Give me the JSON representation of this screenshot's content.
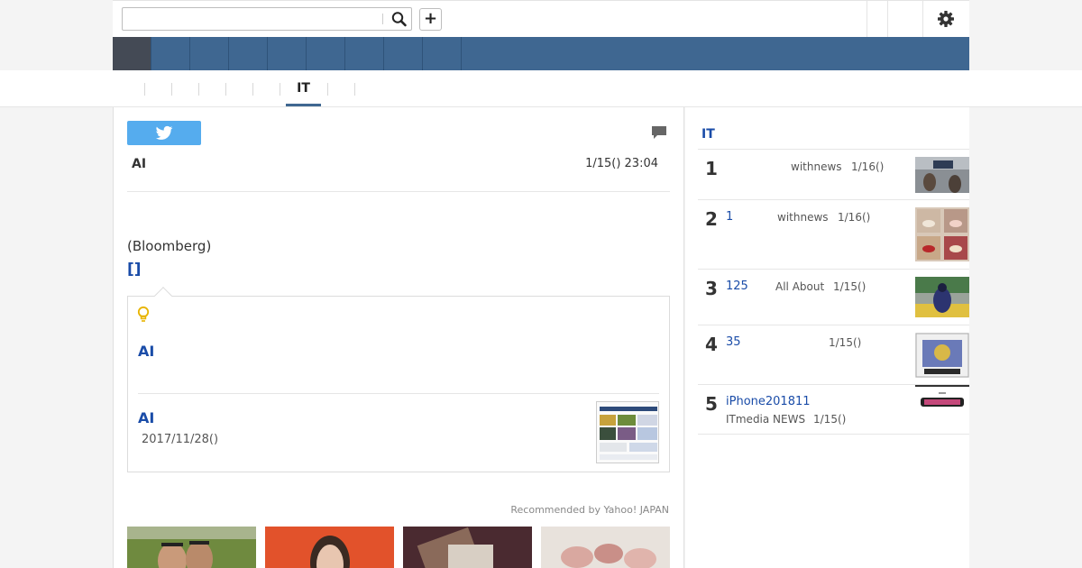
{
  "header": {
    "search": {
      "value": "",
      "placeholder": ""
    },
    "add_label": "+"
  },
  "subnav": {
    "active_tab": "IT"
  },
  "article": {
    "author": "AI",
    "datetime": "1/15() 23:04",
    "source": "(Bloomberg)",
    "source_link": "[]",
    "related": {
      "item1_title": "AI",
      "item2_title": "AI",
      "item2_date": "2017/11/28()"
    },
    "recommended": "Recommended by Yahoo! JAPAN"
  },
  "sidebar": {
    "title": "IT",
    "ranking": [
      {
        "num": "1",
        "title": "",
        "source": "withnews",
        "date": "1/16()"
      },
      {
        "num": "2",
        "title": "1",
        "source": "withnews",
        "date": "1/16()"
      },
      {
        "num": "3",
        "title": "125",
        "source": "All About",
        "date": "1/15()"
      },
      {
        "num": "4",
        "title": "35",
        "source": "",
        "date": "1/15()"
      },
      {
        "num": "5",
        "title": "iPhone201811",
        "source": "ITmedia NEWS",
        "date": "1/15()"
      }
    ]
  },
  "colors": {
    "nav_blue": "#3f6791",
    "nav_active": "#444a55",
    "twitter_blue": "#55acee",
    "link_blue": "#1a4ca8"
  }
}
